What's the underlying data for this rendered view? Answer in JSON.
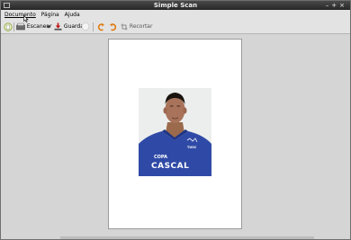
{
  "window": {
    "title": "Simple Scan"
  },
  "menu": {
    "items": [
      "Documento",
      "Página",
      "Ajuda"
    ]
  },
  "toolbar": {
    "scan_label": "Escanear",
    "save_label": "Guardar",
    "crop_label": "Recortar"
  },
  "scan": {
    "shirt_text_1": "COPA",
    "shirt_text_2": "CASCAL",
    "shirt_text_3": "TUSC"
  },
  "colors": {
    "titlebar": "#2f2f2f",
    "toolbar": "#e3e3e3",
    "content_bg": "#d5d5d5",
    "shirt": "#2f4aa6"
  }
}
